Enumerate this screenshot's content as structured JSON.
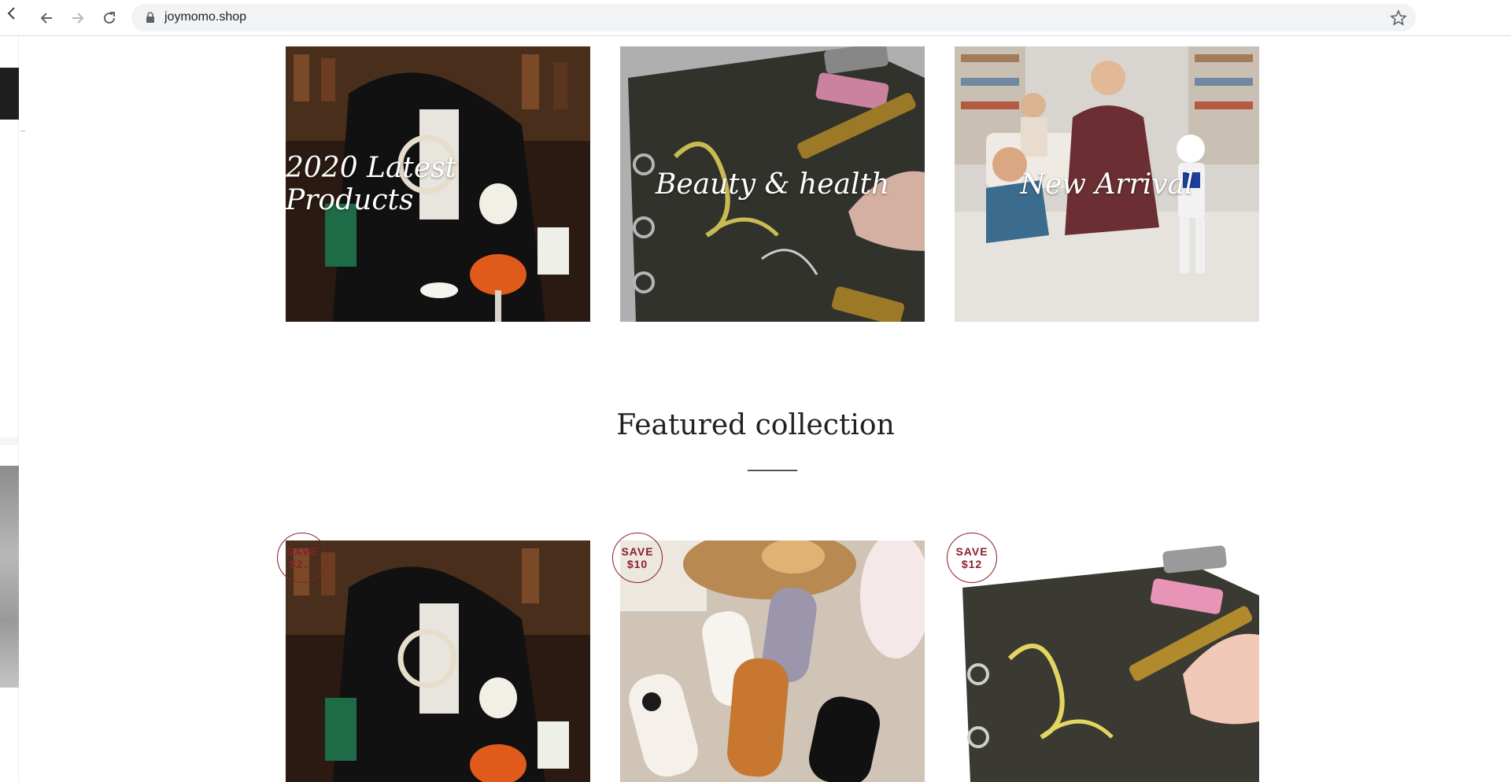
{
  "browser": {
    "url": "joymomo.shop"
  },
  "collections": [
    {
      "title": "2020 Latest Products"
    },
    {
      "title": "Beauty & health"
    },
    {
      "title": "New Arrival"
    }
  ],
  "featured": {
    "heading": "Featured collection"
  },
  "products": [
    {
      "save_label": "SAVE",
      "save_amount": "$2…"
    },
    {
      "save_label": "SAVE",
      "save_amount": "$10"
    },
    {
      "save_label": "SAVE",
      "save_amount": "$12"
    }
  ],
  "colors": {
    "badge": "#8b1e2a",
    "url_bar": "#f1f3f4"
  },
  "icons": [
    "back-icon",
    "forward-icon",
    "reload-icon",
    "lock-icon",
    "star-icon",
    "tab-back-icon"
  ]
}
